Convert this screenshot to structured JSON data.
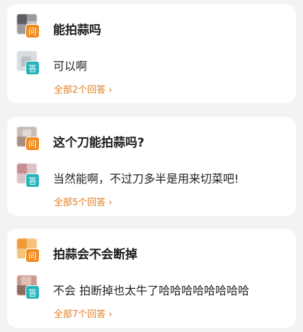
{
  "questions": [
    {
      "question": "能拍蒜吗",
      "answer": "可以啊",
      "more": "全部2个回答",
      "ask_badge": "问",
      "answer_badge": "答"
    },
    {
      "question": "这个刀能拍蒜吗?",
      "answer": "当然能啊，不过刀多半是用来切菜吧!",
      "more": "全部5个回答",
      "ask_badge": "问",
      "answer_badge": "答"
    },
    {
      "question": "拍蒜会不会断掉",
      "answer": "不会 拍断掉也太牛了哈哈哈哈哈哈哈哈",
      "more": "全部7个回答",
      "ask_badge": "问",
      "answer_badge": "答"
    }
  ],
  "icons": {
    "more": "chevron-right-icon"
  },
  "colors": {
    "accent": "#e07b1f",
    "ask_badge": "#f28a1c",
    "answer_badge": "#25b2b9"
  }
}
